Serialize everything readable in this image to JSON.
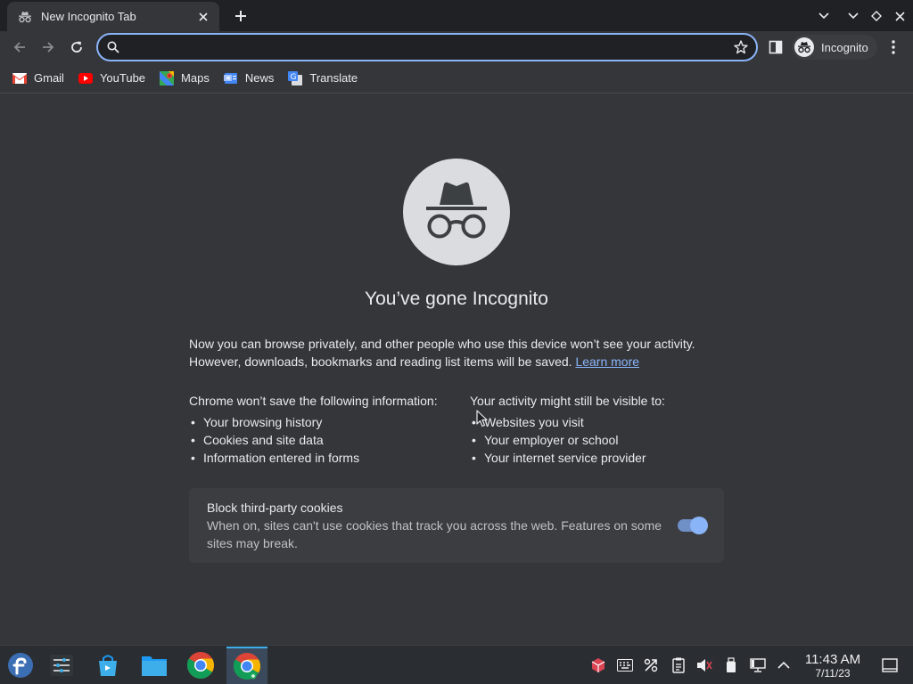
{
  "tab": {
    "title": "New Incognito Tab",
    "favicon": "incognito-icon"
  },
  "omnibox": {
    "value": "",
    "placeholder": ""
  },
  "profile": {
    "label": "Incognito"
  },
  "bookmarks": [
    {
      "label": "Gmail",
      "icon": "gmail-icon"
    },
    {
      "label": "YouTube",
      "icon": "youtube-icon"
    },
    {
      "label": "Maps",
      "icon": "maps-icon"
    },
    {
      "label": "News",
      "icon": "news-icon"
    },
    {
      "label": "Translate",
      "icon": "translate-icon"
    }
  ],
  "page": {
    "heading": "You’ve gone Incognito",
    "intro_line1": "Now you can browse privately, and other people who use this device won’t see your activity.",
    "intro_line2": "However, downloads, bookmarks and reading list items will be saved.",
    "learn_more": "Learn more",
    "left_col": {
      "prefix": "Chrome ",
      "bold": "won’t save",
      "suffix": " the following information:",
      "items": [
        "Your browsing history",
        "Cookies and site data",
        "Information entered in forms"
      ]
    },
    "right_col": {
      "prefix": "Your activity ",
      "bold": "might still be visible",
      "suffix": " to:",
      "items": [
        "Websites you visit",
        "Your employer or school",
        "Your internet service provider"
      ]
    },
    "cookies": {
      "title": "Block third-party cookies",
      "description": "When on, sites can't use cookies that track you across the web. Features on some sites may break.",
      "enabled": true
    }
  },
  "taskbar": {
    "apps": [
      "app-launcher-icon",
      "system-settings-icon",
      "discover-store-icon",
      "file-manager-icon",
      "chrome-icon",
      "chrome-active-icon"
    ],
    "clock": {
      "time": "11:43 AM",
      "date": "7/11/23"
    }
  },
  "colors": {
    "accent": "#8ab4f8",
    "background": "#35363a",
    "tabstrip": "#202124"
  }
}
